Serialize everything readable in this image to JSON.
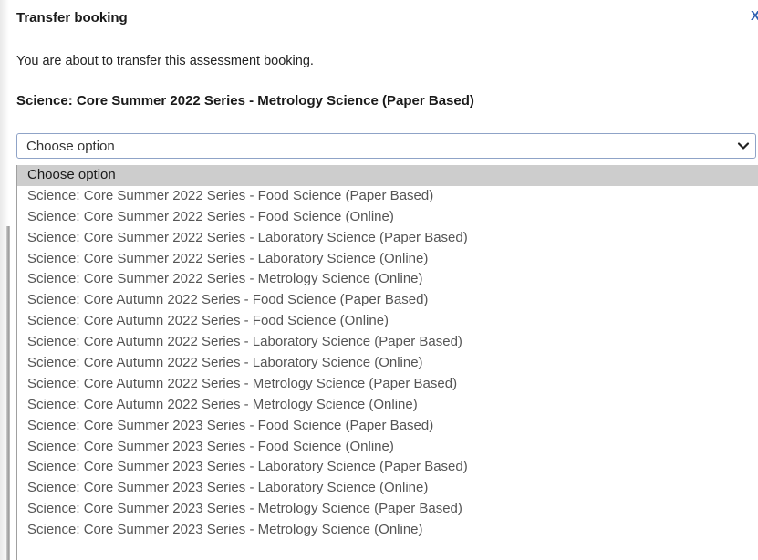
{
  "dialog": {
    "title": "Transfer booking",
    "close_label": "X",
    "intro": "You are about to transfer this assessment booking.",
    "booking_name": "Science: Core Summer 2022 Series - Metrology Science (Paper Based)"
  },
  "select": {
    "value": "Choose option",
    "options": [
      "Choose option",
      "Science: Core Summer 2022 Series - Food Science (Paper Based)",
      "Science: Core Summer 2022 Series - Food Science (Online)",
      "Science: Core Summer 2022 Series - Laboratory Science (Paper Based)",
      "Science: Core Summer 2022 Series - Laboratory Science (Online)",
      "Science: Core Summer 2022 Series - Metrology Science (Online)",
      "Science: Core Autumn 2022 Series - Food Science (Paper Based)",
      "Science: Core Autumn 2022 Series - Food Science (Online)",
      "Science: Core Autumn 2022 Series - Laboratory Science (Paper Based)",
      "Science: Core Autumn 2022 Series - Laboratory Science (Online)",
      "Science: Core Autumn 2022 Series - Metrology Science (Paper Based)",
      "Science: Core Autumn 2022 Series - Metrology Science (Online)",
      "Science: Core Summer 2023 Series - Food Science (Paper Based)",
      "Science: Core Summer 2023 Series - Food Science (Online)",
      "Science: Core Summer 2023 Series - Laboratory Science (Paper Based)",
      "Science: Core Summer 2023 Series - Laboratory Science (Online)",
      "Science: Core Summer 2023 Series - Metrology Science (Paper Based)",
      "Science: Core Summer 2023 Series - Metrology Science (Online)"
    ],
    "selected_index": 0
  },
  "colors": {
    "close": "#2f5fb0",
    "select_border": "#8fa3c7",
    "option_highlight": "#cdcdcd",
    "option_text": "#555555"
  }
}
